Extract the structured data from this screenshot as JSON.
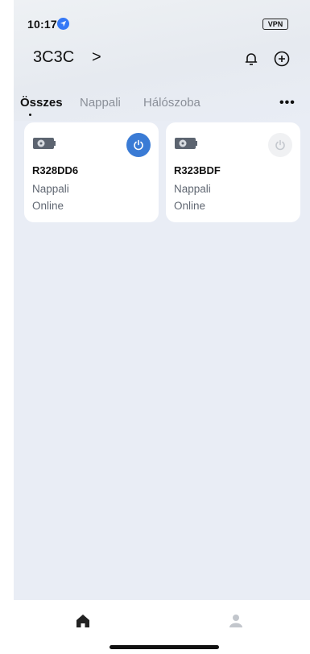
{
  "status_bar": {
    "time": "10:17",
    "vpn": "VPN"
  },
  "header": {
    "home_name": "3C3C",
    "chevron": ">"
  },
  "tabs": [
    {
      "label": "Összes",
      "active": true
    },
    {
      "label": "Nappali",
      "active": false
    },
    {
      "label": "Hálószoba",
      "active": false
    }
  ],
  "more_label": "•••",
  "devices": [
    {
      "name": "R328DD6",
      "room": "Nappali",
      "status": "Online",
      "power_on": true
    },
    {
      "name": "R323BDF",
      "room": "Nappali",
      "status": "Online",
      "power_on": false
    }
  ],
  "colors": {
    "accent": "#3a7bd5",
    "background": "#e9edf5",
    "card": "#ffffff",
    "muted_text": "#606772"
  },
  "icons": {
    "location": "location-arrow-icon",
    "bell": "bell-icon",
    "add": "plus-circle-icon",
    "device": "device-icon",
    "power": "power-icon",
    "home": "home-icon",
    "profile": "profile-icon"
  }
}
